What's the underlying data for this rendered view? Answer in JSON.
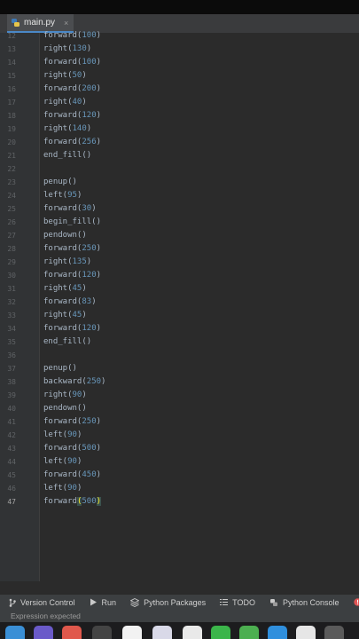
{
  "tab": {
    "filename": "main.py",
    "close": "×"
  },
  "editor": {
    "lines": [
      {
        "n": "12",
        "pre": "forward(",
        "num": "100",
        "post": ")"
      },
      {
        "n": "13",
        "pre": "right(",
        "num": "130",
        "post": ")"
      },
      {
        "n": "14",
        "pre": "forward(",
        "num": "100",
        "post": ")"
      },
      {
        "n": "15",
        "pre": "right(",
        "num": "50",
        "post": ")"
      },
      {
        "n": "16",
        "pre": "forward(",
        "num": "200",
        "post": ")"
      },
      {
        "n": "17",
        "pre": "right(",
        "num": "40",
        "post": ")"
      },
      {
        "n": "18",
        "pre": "forward(",
        "num": "120",
        "post": ")"
      },
      {
        "n": "19",
        "pre": "right(",
        "num": "140",
        "post": ")"
      },
      {
        "n": "20",
        "pre": "forward(",
        "num": "256",
        "post": ")"
      },
      {
        "n": "21",
        "pre": "end_fill()",
        "num": "",
        "post": ""
      },
      {
        "n": "22",
        "pre": "",
        "num": "",
        "post": ""
      },
      {
        "n": "23",
        "pre": "penup()",
        "num": "",
        "post": ""
      },
      {
        "n": "24",
        "pre": "left(",
        "num": "95",
        "post": ")"
      },
      {
        "n": "25",
        "pre": "forward(",
        "num": "30",
        "post": ")"
      },
      {
        "n": "26",
        "pre": "begin_fill()",
        "num": "",
        "post": ""
      },
      {
        "n": "27",
        "pre": "pendown()",
        "num": "",
        "post": ""
      },
      {
        "n": "28",
        "pre": "forward(",
        "num": "250",
        "post": ")"
      },
      {
        "n": "29",
        "pre": "right(",
        "num": "135",
        "post": ")"
      },
      {
        "n": "30",
        "pre": "forward(",
        "num": "120",
        "post": ")"
      },
      {
        "n": "31",
        "pre": "right(",
        "num": "45",
        "post": ")"
      },
      {
        "n": "32",
        "pre": "forward(",
        "num": "83",
        "post": ")"
      },
      {
        "n": "33",
        "pre": "right(",
        "num": "45",
        "post": ")"
      },
      {
        "n": "34",
        "pre": "forward(",
        "num": "120",
        "post": ")"
      },
      {
        "n": "35",
        "pre": "end_fill()",
        "num": "",
        "post": ""
      },
      {
        "n": "36",
        "pre": "",
        "num": "",
        "post": ""
      },
      {
        "n": "37",
        "pre": "penup()",
        "num": "",
        "post": ""
      },
      {
        "n": "38",
        "pre": "backward(",
        "num": "250",
        "post": ")"
      },
      {
        "n": "39",
        "pre": "right(",
        "num": "90",
        "post": ")"
      },
      {
        "n": "40",
        "pre": "pendown()",
        "num": "",
        "post": ""
      },
      {
        "n": "41",
        "pre": "forward(",
        "num": "250",
        "post": ")"
      },
      {
        "n": "42",
        "pre": "left(",
        "num": "90",
        "post": ")"
      },
      {
        "n": "43",
        "pre": "forward(",
        "num": "500",
        "post": ")"
      },
      {
        "n": "44",
        "pre": "left(",
        "num": "90",
        "post": ")"
      },
      {
        "n": "45",
        "pre": "forward(",
        "num": "450",
        "post": ")"
      },
      {
        "n": "46",
        "pre": "left(",
        "num": "90",
        "post": ")"
      },
      {
        "n": "47",
        "pre": "forward",
        "num": "500",
        "post": ")",
        "active": true,
        "open": "("
      }
    ]
  },
  "statusbar": {
    "version_control": "Version Control",
    "run": "Run",
    "python_packages": "Python Packages",
    "todo": "TODO",
    "python_console": "Python Console",
    "problems": "Pr"
  },
  "message": "Expression expected",
  "colors": {
    "accent": "#4a88c7",
    "number": "#6897bb",
    "code": "#a9b7c6",
    "background": "#2b2b2b"
  }
}
